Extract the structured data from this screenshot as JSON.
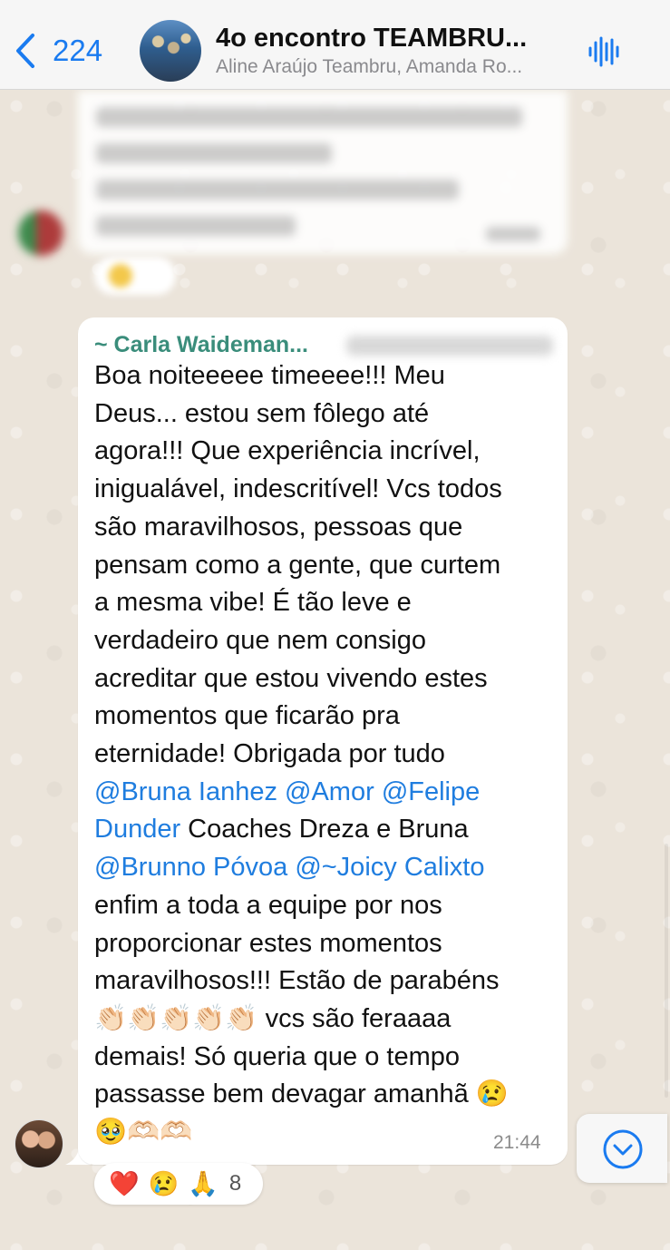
{
  "header": {
    "back_count": "224",
    "title": "4o encontro TEAMBRU...",
    "subtitle": "Aline Araújo Teambru, Amanda Ro..."
  },
  "message": {
    "sender": "~ Carla Waideman...",
    "segments": [
      {
        "text": "Boa noiteeeee timeeee!!! Meu\nDeus... estou sem fôlego até\nagora!!! Que experiência incrível,\ninigualável, indescritível! Vcs todos\nsão maravilhosos, pessoas que\npensam como a gente, que curtem\na mesma vibe! É tão leve e\nverdadeiro que nem consigo\nacreditar que estou vivendo estes\nmomentos que ficarão pra\neternidade! Obrigada por tudo\n",
        "mention": false
      },
      {
        "text": "@Bruna Ianhez",
        "mention": true
      },
      {
        "text": " ",
        "mention": false
      },
      {
        "text": "@Amor",
        "mention": true
      },
      {
        "text": " ",
        "mention": false
      },
      {
        "text": "@Felipe\nDunder",
        "mention": true
      },
      {
        "text": " Coaches Dreza e Bruna\n",
        "mention": false
      },
      {
        "text": "@Brunno Póvoa",
        "mention": true
      },
      {
        "text": "  ",
        "mention": false
      },
      {
        "text": "@~Joicy Calixto",
        "mention": true
      },
      {
        "text": "\nenfim a toda a equipe por nos\nproporcionar estes momentos\nmaravilhosos!!! Estão de parabéns\n👏🏻👏🏻👏🏻👏🏻👏🏻 vcs são feraaaa\ndemais! Só queria que o tempo\npassasse bem devagar amanhã 😢\n🥹🫶🏻🫶🏻",
        "mention": false
      }
    ],
    "time": "21:44"
  },
  "reactions": {
    "emojis": [
      "❤️",
      "😢",
      "🙏"
    ],
    "count": "8"
  },
  "colors": {
    "accent": "#1a7bf0",
    "sender_name": "#3a8d7b",
    "mention": "#1f7ddf"
  },
  "icons": {
    "back": "chevron-left-icon",
    "audio": "waveform-icon",
    "scroll": "chevron-down-circle-icon"
  }
}
